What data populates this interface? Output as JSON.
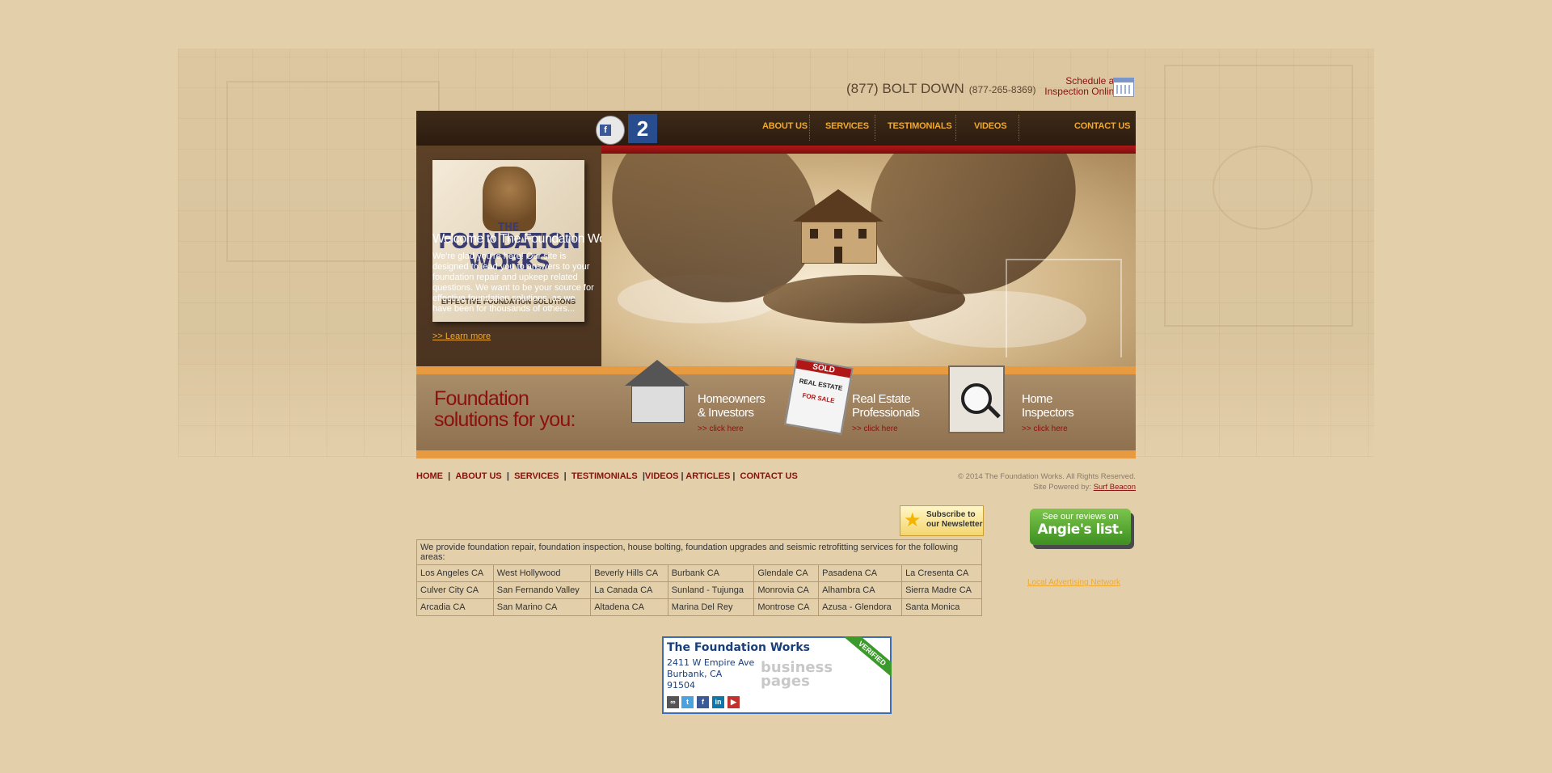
{
  "header": {
    "phone_main": "(877) BOLT DOWN",
    "phone_digits": "(877-265-8369)",
    "schedule_line1": "Schedule an",
    "schedule_line2": "Inspection Online"
  },
  "nav": {
    "about": "ABOUT US",
    "services": "SERVICES",
    "testimonials": "TESTIMONIALS",
    "videos": "VIDEOS",
    "contact": "CONTACT US"
  },
  "logo": {
    "line1": "THE",
    "line2": "FOUNDATION WORKS",
    "tagline": "EFFECTIVE FOUNDATION SOLUTIONS"
  },
  "social_badge": "2",
  "welcome": {
    "title": "Welcome to The Foundation Works",
    "text": "We're glad you're here! Our site is designed to lead you to answers to your foundation repair and upkeep related questions. We want to be your source for effective foundation solutions, as we have been for thousands of others...",
    "link": ">> Learn more"
  },
  "solutions": {
    "line1": "Foundation",
    "line2": "solutions for you:",
    "items": [
      {
        "line1": "Homeowners",
        "line2": "& Investors",
        "link": ">> click here"
      },
      {
        "line1": "Real Estate",
        "line2": "Professionals",
        "link": ">> click here"
      },
      {
        "line1": "Home",
        "line2": "Inspectors",
        "link": ">> click here"
      }
    ],
    "sold_sign": "SOLD",
    "real_estate_sign": "REAL ESTATE",
    "for_sale_sign": "FOR SALE"
  },
  "footer_nav": [
    "HOME",
    "ABOUT US",
    "SERVICES",
    "TESTIMONIALS",
    "VIDEOS",
    "ARTICLES",
    "CONTACT US"
  ],
  "copyright": "© 2014 The Foundation Works. All Rights Reserved.",
  "powered_by_label": "Site Powered by:",
  "powered_by_link": "Surf Beacon",
  "newsletter": {
    "line1": "Subscribe to",
    "line2": "our Newsletter"
  },
  "service_area": {
    "intro": "We provide foundation repair, foundation inspection, house bolting, foundation upgrades and seismic retrofitting services for the following areas:",
    "rows": [
      [
        "Los Angeles CA",
        "West Hollywood",
        "Beverly Hills CA",
        "Burbank CA",
        "Glendale CA",
        "Pasadena CA",
        "La Cresenta CA"
      ],
      [
        "Culver City CA",
        "San Fernando Valley",
        "La Canada CA",
        "Sunland - Tujunga",
        "Monrovia CA",
        "Alhambra CA",
        "Sierra Madre CA"
      ],
      [
        "Arcadia CA",
        "San Marino CA",
        "Altadena CA",
        "Marina Del Rey",
        "Montrose CA",
        "Azusa - Glendora",
        "Santa Monica"
      ]
    ]
  },
  "angies": {
    "line1": "See our reviews on",
    "line2": "Angie's list."
  },
  "local_ad": "Local Advertising Network",
  "bizcard": {
    "name": "The Foundation Works",
    "street": "2411 W Empire Ave",
    "city": "Burbank, CA",
    "zip": "91504",
    "watermark1": "business",
    "watermark2": "pages",
    "verified": "VERIFIED"
  },
  "colors": {
    "background": "#e3cfaa",
    "accent_orange": "#f0a92e",
    "brand_red": "#8b1010",
    "dark_brown": "#3e2a18"
  }
}
